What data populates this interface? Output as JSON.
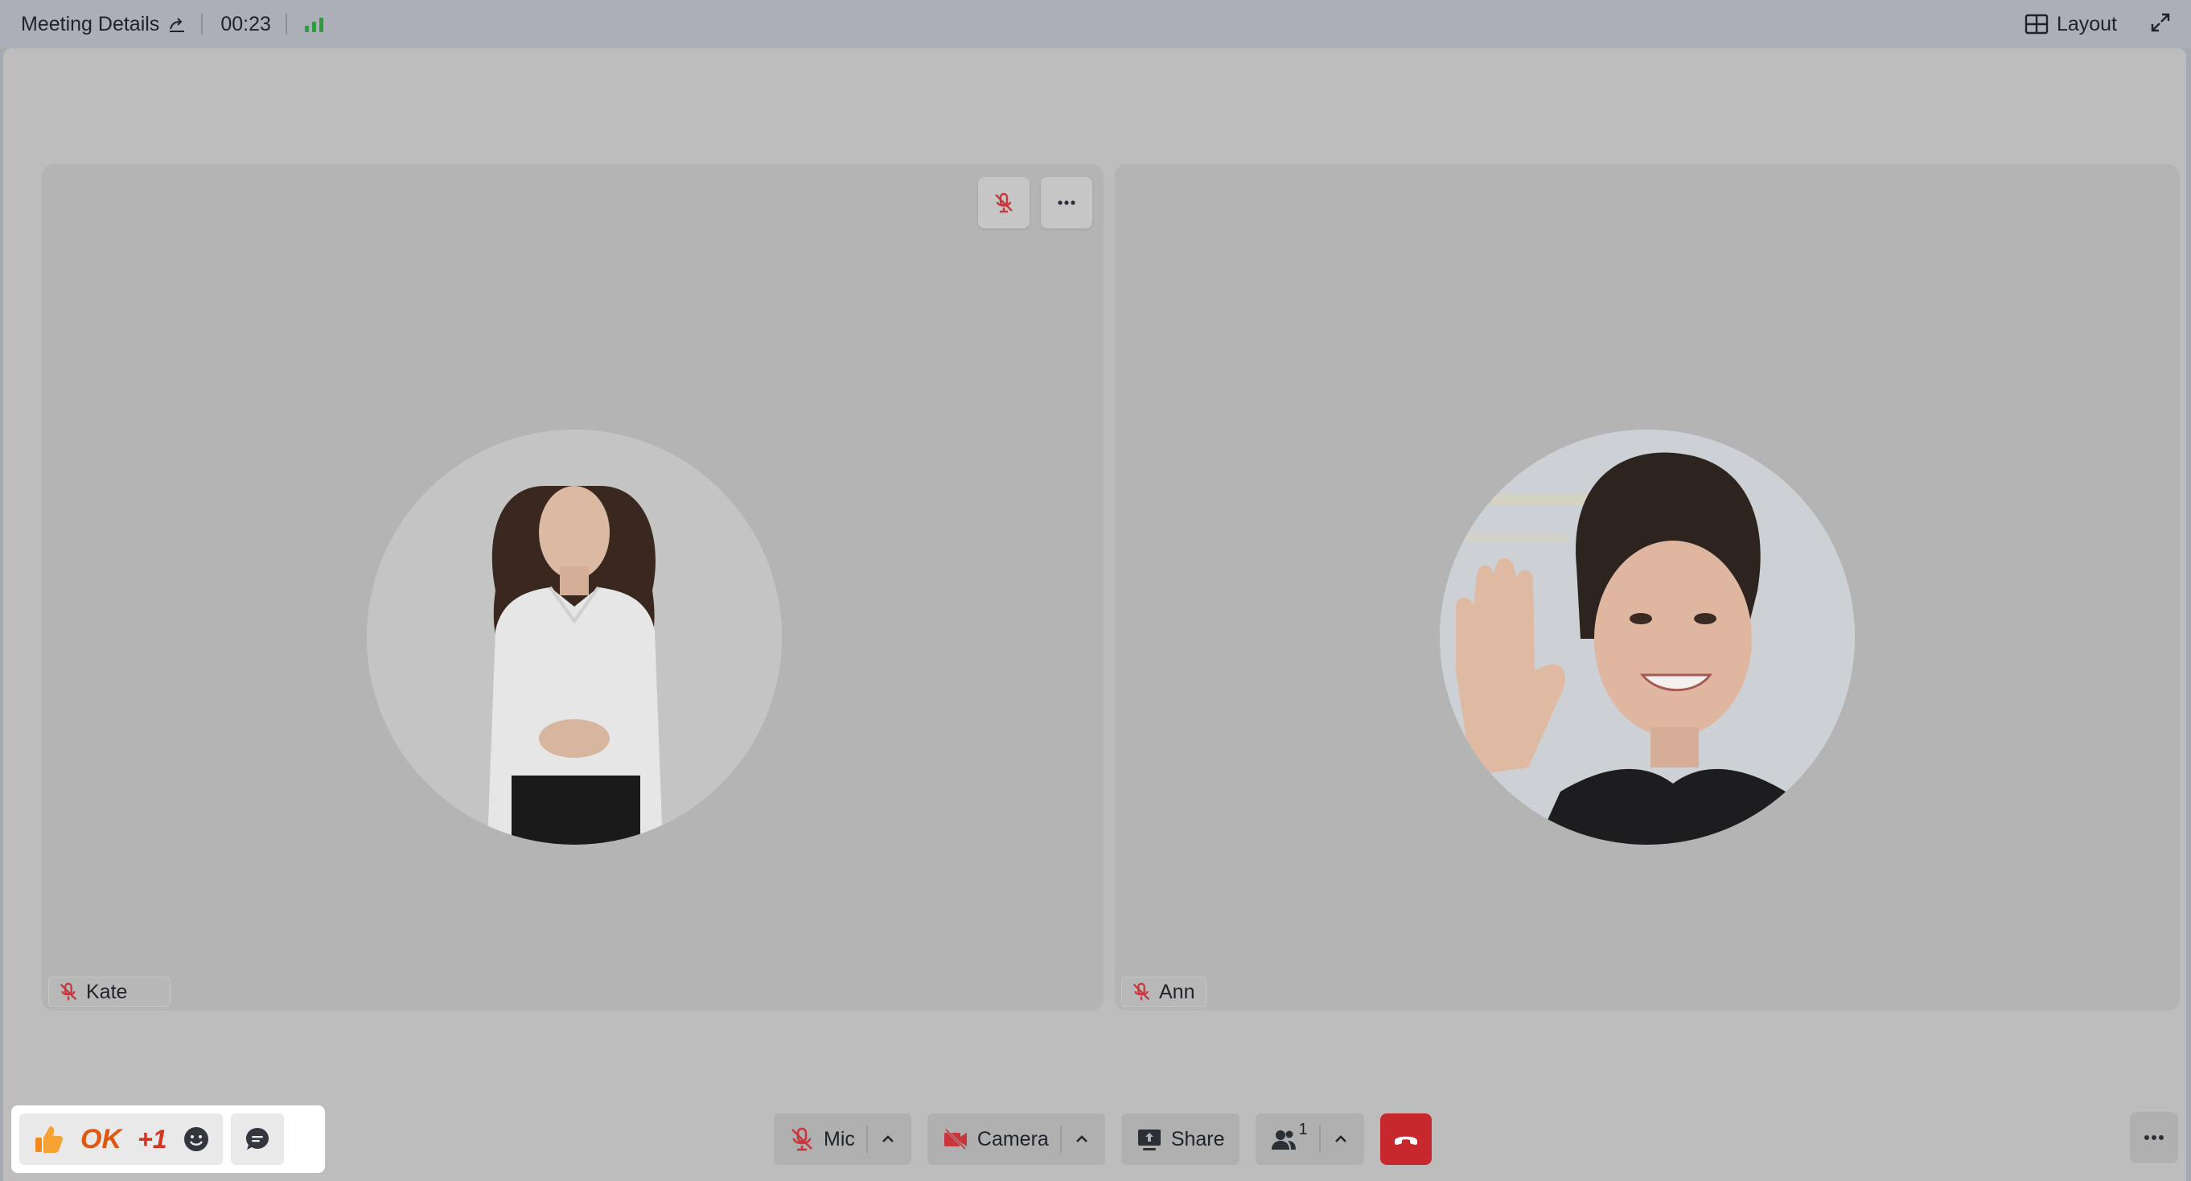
{
  "header": {
    "title": "Meeting Details",
    "timer": "00:23",
    "layout_label": "Layout",
    "icons": [
      "share-arrow-icon",
      "signal-bars-icon",
      "grid-layout-icon",
      "expand-icon"
    ]
  },
  "participants": [
    {
      "name": "Kate",
      "muted": true,
      "photo": "woman-in-white-blouse"
    },
    {
      "name": "Ann",
      "muted": true,
      "photo": "woman-waving"
    }
  ],
  "tile_controls": {
    "icons": [
      "mic-muted-icon",
      "more-horizontal-icon"
    ]
  },
  "reactions": {
    "ok_label": "OK",
    "plus_one_label": "+1",
    "icons": [
      "thumbs-up-icon",
      "emoji-icon",
      "chat-icon"
    ]
  },
  "toolbar": {
    "mic_label": "Mic",
    "camera_label": "Camera",
    "share_label": "Share",
    "participants_count": "1"
  },
  "colors": {
    "accent_red": "#c6282d",
    "signal_green": "#2b9d3c",
    "muted_red": "#c8353a"
  }
}
